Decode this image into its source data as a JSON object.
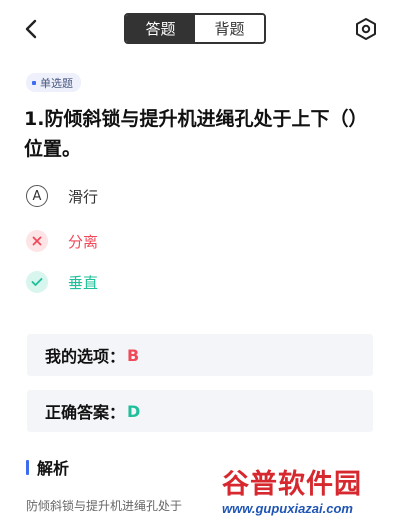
{
  "header": {
    "back_icon": "chevron-left-icon",
    "tabs": [
      {
        "label": "答题",
        "active": true
      },
      {
        "label": "背题",
        "active": false
      }
    ],
    "settings_icon": "hexagon-settings-icon"
  },
  "question": {
    "type_tag": "单选题",
    "text": "1.防倾斜锁与提升机进绳孔处于上下（）位置。",
    "options": [
      {
        "marker": "A",
        "text": "滑行",
        "state": "neutral"
      },
      {
        "marker": "✕",
        "text": "分离",
        "state": "wrong"
      },
      {
        "marker": "✓",
        "text": "垂直",
        "state": "correct"
      }
    ]
  },
  "result": {
    "my_choice_label": "我的选项：",
    "my_choice_value": "B",
    "correct_label": "正确答案：",
    "correct_value": "D"
  },
  "analysis": {
    "title": "解析",
    "text": "防倾斜锁与提升机进绳孔处于"
  },
  "watermark": {
    "main": "谷普软件园",
    "url": "www.gupuxiazai.com"
  },
  "colors": {
    "accent": "#3d6cf0",
    "wrong": "#f04a5a",
    "correct": "#1fbf9b",
    "tab_active": "#333333"
  }
}
